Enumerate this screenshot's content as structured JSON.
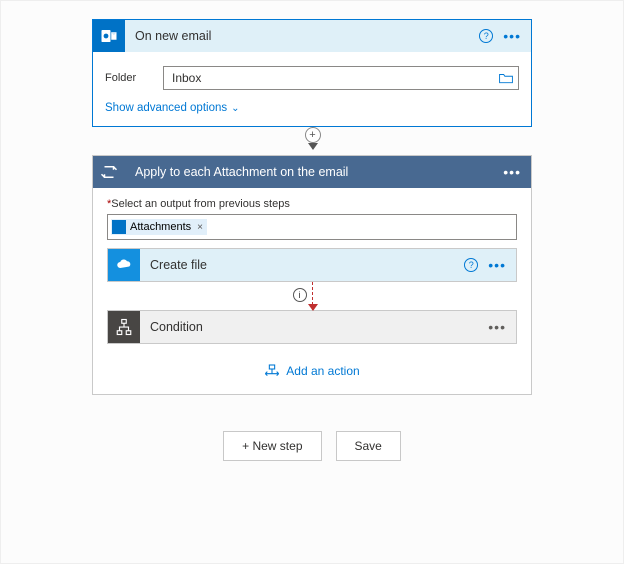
{
  "trigger": {
    "title": "On new email",
    "folder_label": "Folder",
    "folder_value": "Inbox",
    "advanced_label": "Show advanced options"
  },
  "for_each": {
    "title": "Apply to each Attachment on the email",
    "select_label_req": "*",
    "select_label": "Select an output from previous steps",
    "token": "Attachments",
    "token_x": "×"
  },
  "create_file": {
    "title": "Create file"
  },
  "condition": {
    "title": "Condition"
  },
  "add_action_label": "Add an action",
  "buttons": {
    "new_step": "+ New step",
    "save": "Save"
  }
}
